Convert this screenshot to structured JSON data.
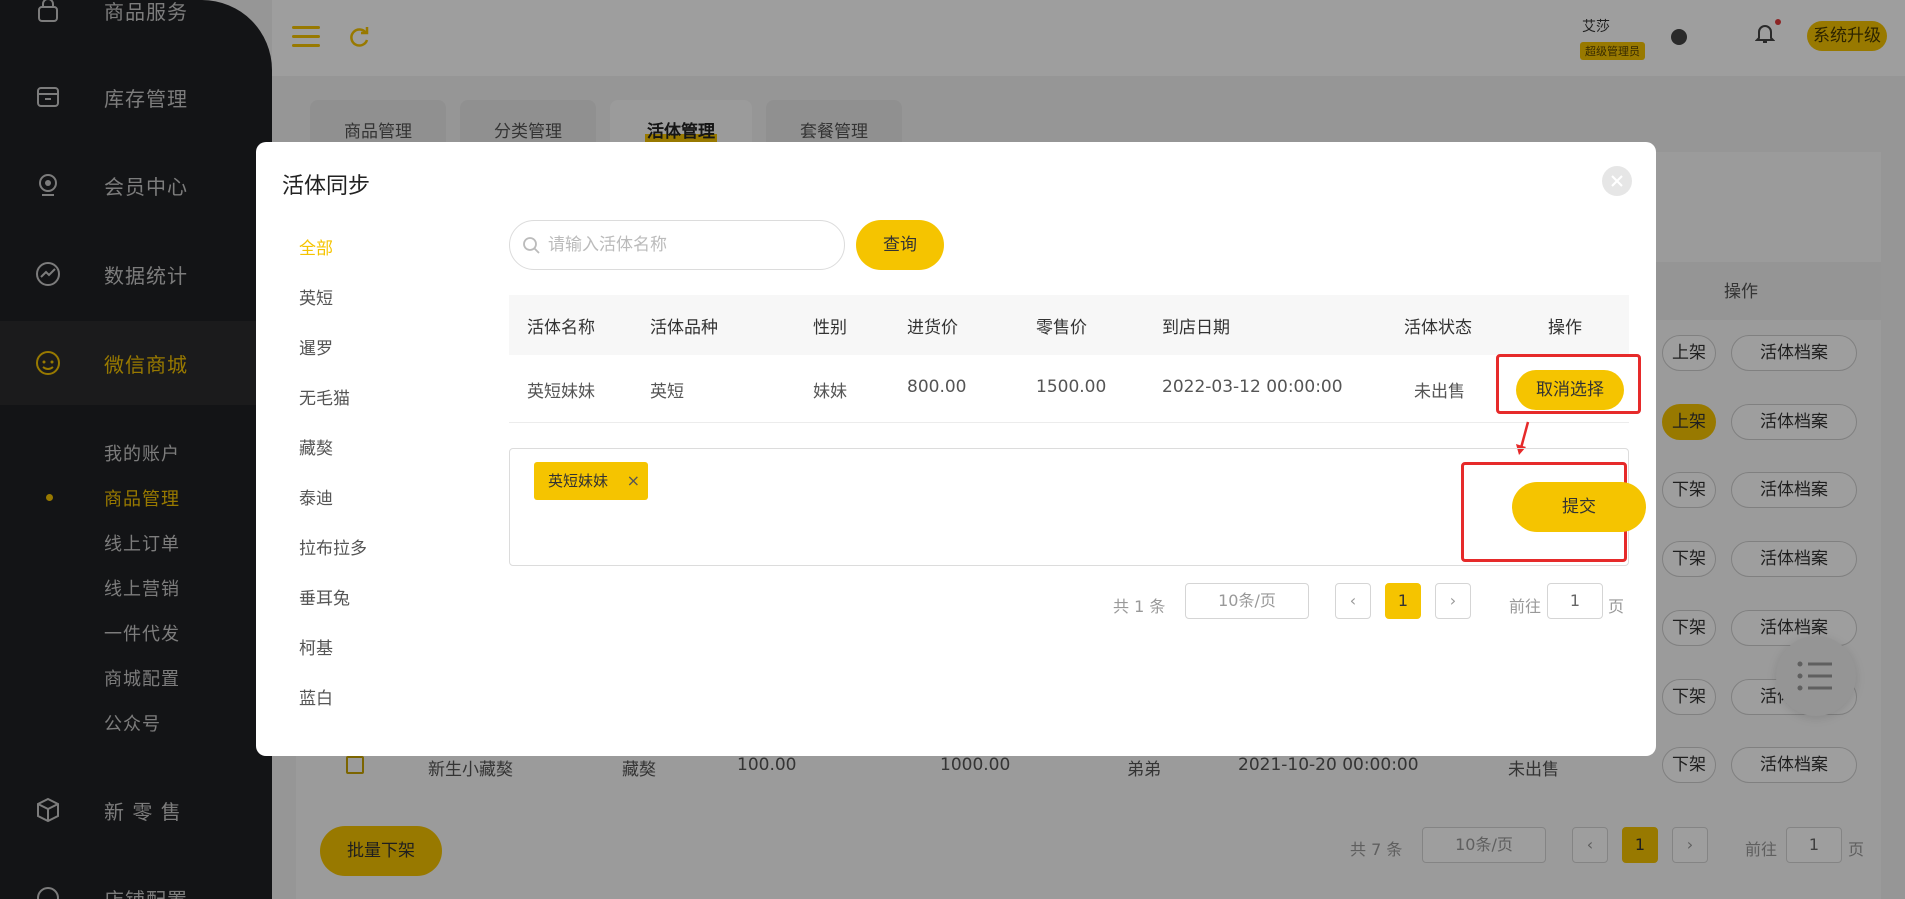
{
  "sidebar": {
    "items": [
      {
        "label": "商品服务",
        "icon": "lock-icon"
      },
      {
        "label": "库存管理",
        "icon": "inventory-box-icon"
      },
      {
        "label": "会员中心",
        "icon": "member-icon"
      },
      {
        "label": "数据统计",
        "icon": "chart-icon"
      },
      {
        "label": "微信商城",
        "icon": "wechat-mall-icon"
      },
      {
        "label": "新 零 售",
        "icon": "cube-icon"
      },
      {
        "label": "店铺配置",
        "icon": "store-config-icon"
      }
    ],
    "sub_items": [
      "我的账户",
      "商品管理",
      "线上订单",
      "线上营销",
      "一件代发",
      "商城配置",
      "公众号"
    ]
  },
  "header": {
    "user_name": "艾莎",
    "user_role": "超级管理员",
    "upgrade_label": "系统升级"
  },
  "page": {
    "tabs": [
      "商品管理",
      "分类管理",
      "活体管理",
      "套餐管理"
    ],
    "op_header": "操作",
    "row_buttons": [
      [
        "上架",
        "活体档案"
      ],
      [
        "上架",
        "活体档案"
      ],
      [
        "下架",
        "活体档案"
      ],
      [
        "下架",
        "活体档案"
      ],
      [
        "下架",
        "活体档案"
      ],
      [
        "下架",
        "活体档案"
      ],
      [
        "下架",
        "活体档案"
      ]
    ],
    "last_row": {
      "name": "新生小藏獒",
      "breed": "藏獒",
      "cost": "100.00",
      "retail": "1000.00",
      "gender": "弟弟",
      "date": "2021-10-20 00:00:00",
      "status": "未出售"
    },
    "batch_label": "批量下架",
    "pager": {
      "total": "共 7 条",
      "size": "10条/页",
      "page": "1",
      "goto": "前往",
      "goto_value": "1",
      "unit": "页"
    }
  },
  "dialog": {
    "title": "活体同步",
    "categories": [
      "全部",
      "英短",
      "暹罗",
      "无毛猫",
      "藏獒",
      "泰迪",
      "拉布拉多",
      "垂耳兔",
      "柯基",
      "蓝白"
    ],
    "search": {
      "placeholder": "请输入活体名称",
      "value": ""
    },
    "query_label": "查询",
    "columns": [
      "活体名称",
      "活体品种",
      "性别",
      "进货价",
      "零售价",
      "到店日期",
      "活体状态",
      "操作"
    ],
    "rows": [
      {
        "name": "英短妹妹",
        "breed": "英短",
        "gender": "妹妹",
        "cost": "800.00",
        "retail": "1500.00",
        "date": "2022-03-12 00:00:00",
        "status": "未出售",
        "action": "取消选择"
      }
    ],
    "selected_tags": [
      "英短妹妹"
    ],
    "submit_label": "提交",
    "pager": {
      "total": "共 1 条",
      "size": "10条/页",
      "page": "1",
      "goto": "前往",
      "goto_value": "1",
      "unit": "页"
    }
  },
  "colors": {
    "accent": "#f5c400",
    "sidebar_bg": "#202124",
    "annotation": "#e62a2a"
  }
}
